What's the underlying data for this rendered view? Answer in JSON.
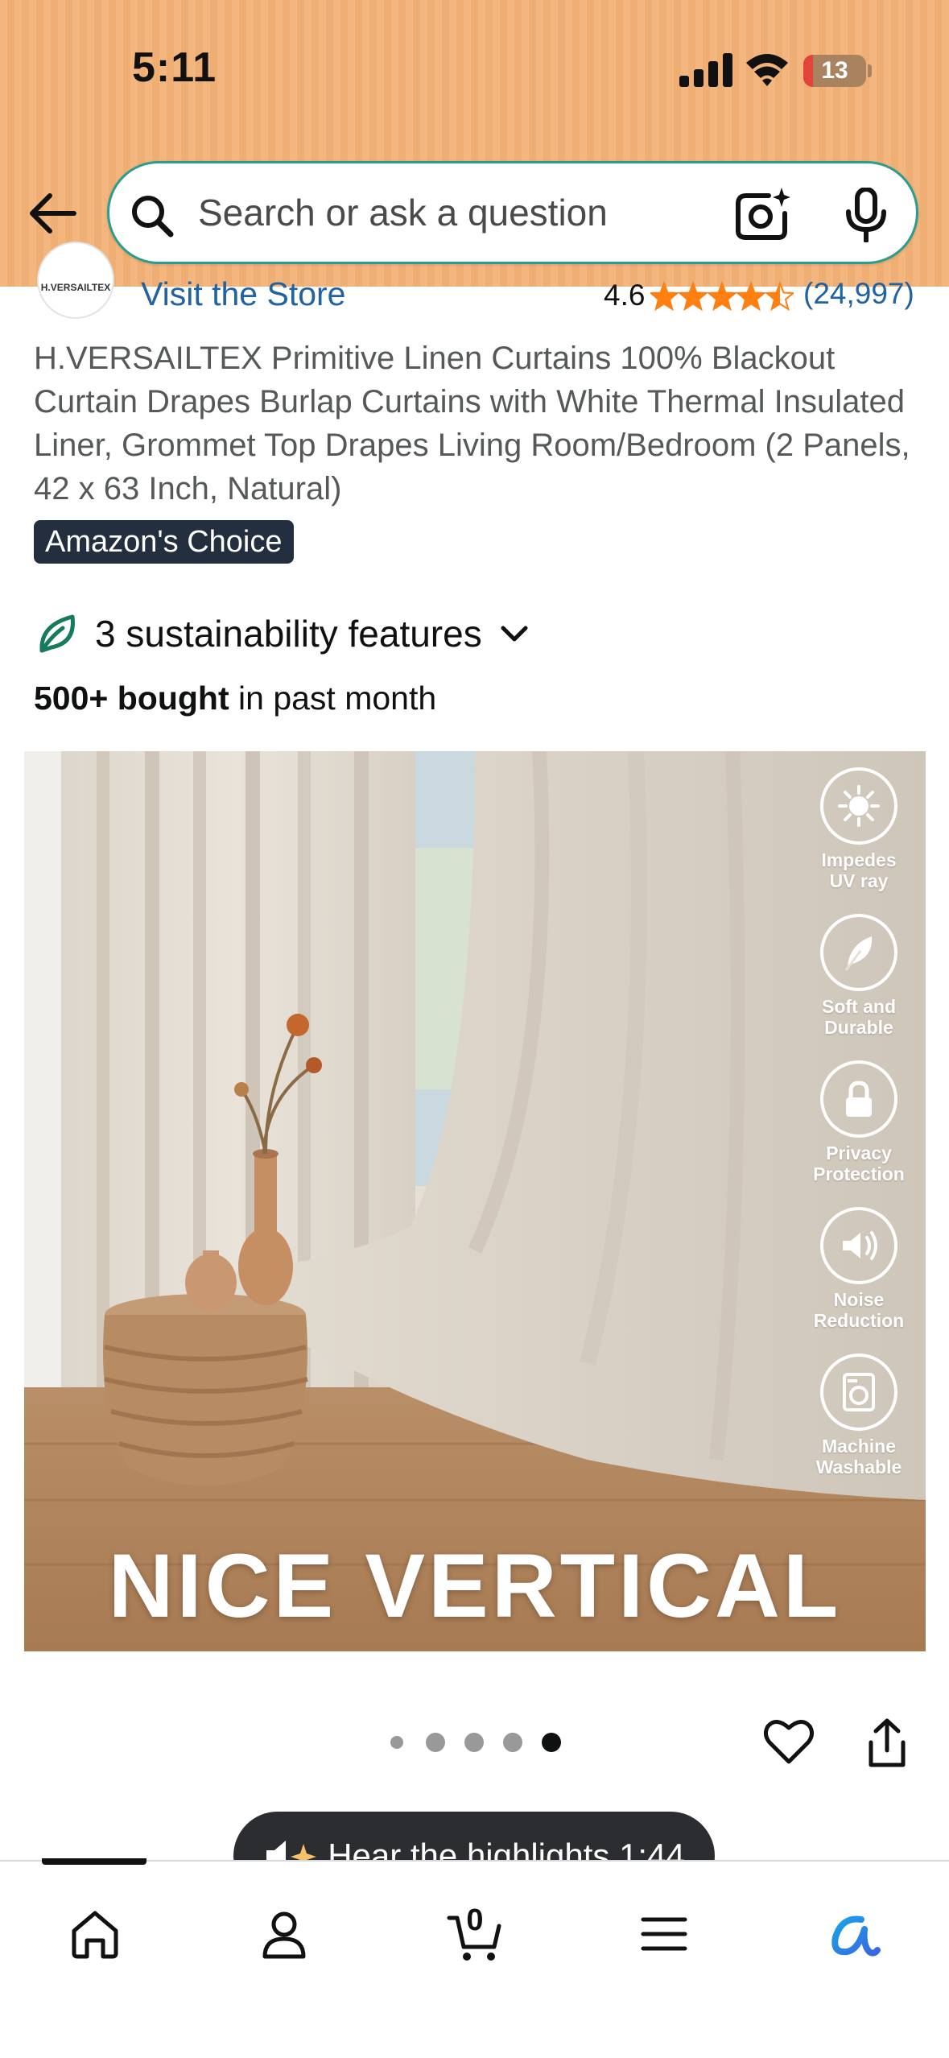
{
  "status_bar": {
    "time": "5:11",
    "battery": "13"
  },
  "search": {
    "placeholder": "Search or ask a question"
  },
  "store": {
    "logo_text": "H.VERSAILTEX",
    "visit_label": "Visit the Store",
    "rating": "4.6",
    "review_count": "(24,997)",
    "stars_value": 4.5
  },
  "product": {
    "title": "H.VERSAILTEX Primitive Linen Curtains 100% Blackout Curtain Drapes Burlap Curtains with White Thermal Insulated Liner, Grommet Top Drapes Living Room/Bedroom (2 Panels, 42 x 63 Inch, Natural)",
    "badge": "Amazon's Choice",
    "sustainability": "3 sustainability features",
    "bought_bold": "500+ bought",
    "bought_rest": " in past month"
  },
  "image": {
    "caption": "NICE VERTICAL",
    "features": [
      {
        "label": "Impedes\nUV ray",
        "icon": "sun-icon"
      },
      {
        "label": "Soft and\nDurable",
        "icon": "feather-icon"
      },
      {
        "label": "Privacy\nProtection",
        "icon": "lock-icon"
      },
      {
        "label": "Noise\nReduction",
        "icon": "speaker-icon"
      },
      {
        "label": "Machine\nWashable",
        "icon": "washer-icon"
      }
    ]
  },
  "carousel": {
    "total": 5,
    "active_index": 4
  },
  "highlights": {
    "label": "Hear the highlights 1:44"
  },
  "nav": {
    "cart_count": "0",
    "items": [
      "home-icon",
      "account-icon",
      "cart-icon",
      "menu-icon",
      "rufus-icon"
    ]
  },
  "colors": {
    "header": "#f3b67e",
    "link": "#2162a1",
    "star": "#ff7f11",
    "badge": "#232f3e"
  }
}
